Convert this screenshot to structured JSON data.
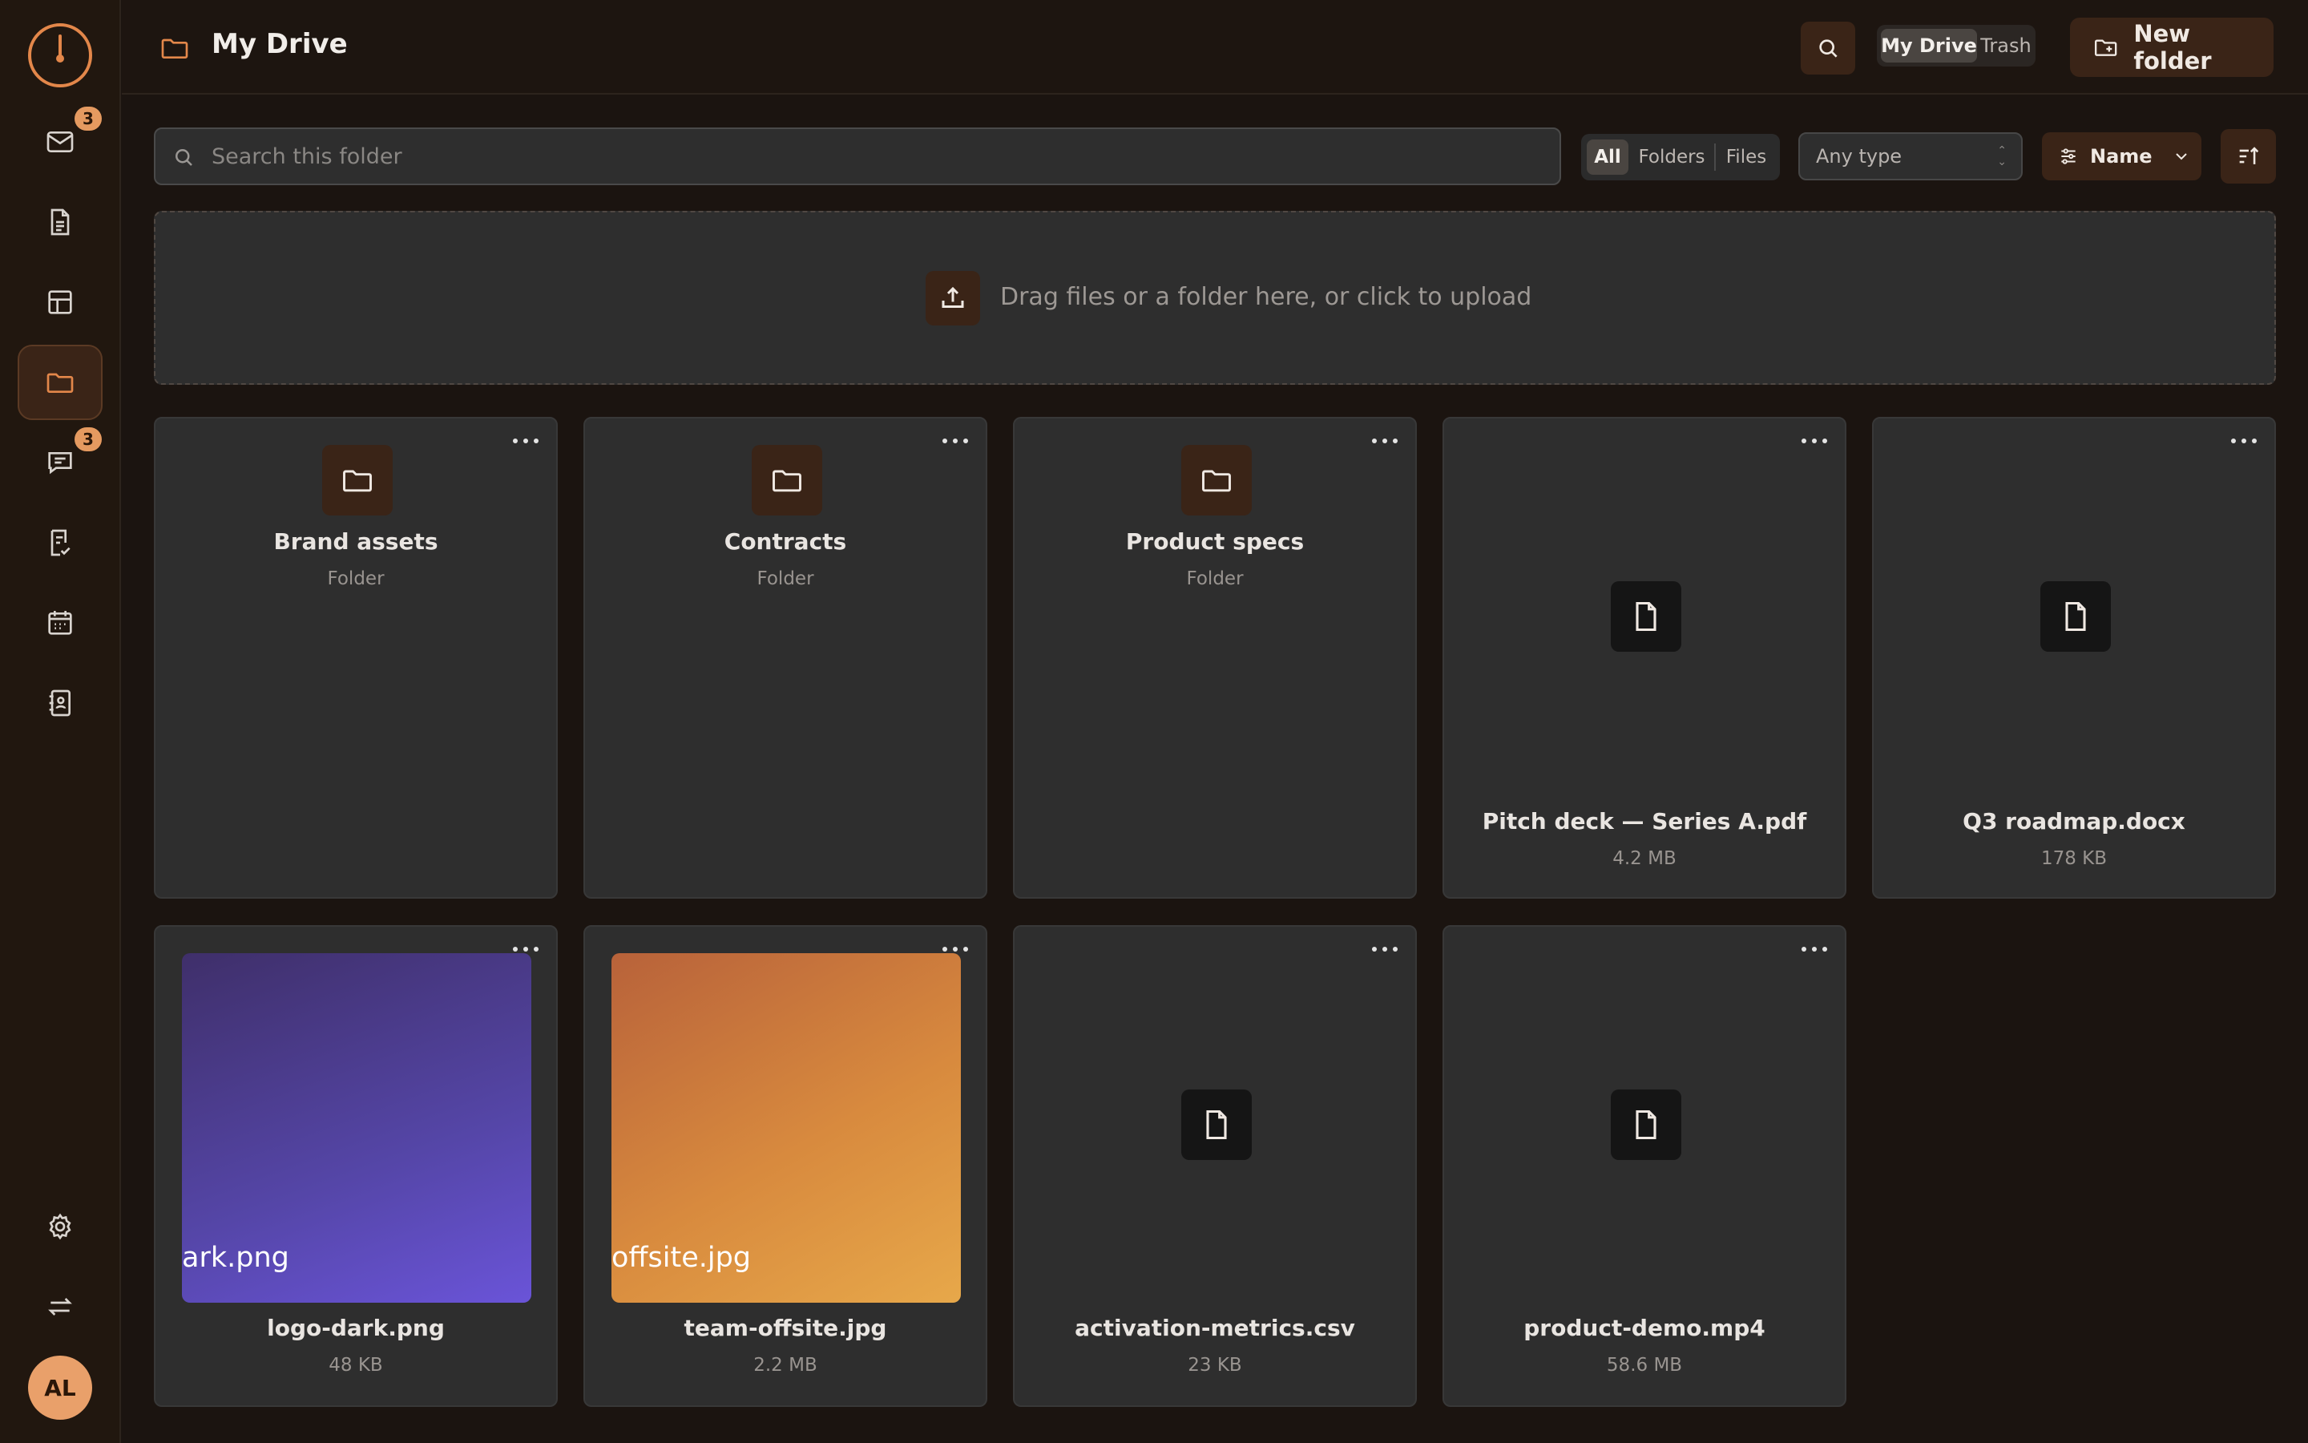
{
  "header": {
    "title": "My Drive",
    "tabs": [
      {
        "label": "My Drive",
        "active": true
      },
      {
        "label": "Trash",
        "active": false
      }
    ],
    "new_folder_label": "New folder"
  },
  "toolbar": {
    "search_placeholder": "Search this folder",
    "filters": [
      {
        "label": "All",
        "active": true
      },
      {
        "label": "Folders",
        "active": false
      },
      {
        "label": "Files",
        "active": false
      }
    ],
    "type_select": "Any type",
    "sort_label": "Name"
  },
  "dropzone": {
    "text": "Drag files or a folder here, or click to upload"
  },
  "sidebar": {
    "badges": {
      "mail": "3",
      "chat": "3"
    },
    "avatar_initials": "AL"
  },
  "items": [
    {
      "name": "Brand assets",
      "meta": "Folder",
      "kind": "folder"
    },
    {
      "name": "Contracts",
      "meta": "Folder",
      "kind": "folder"
    },
    {
      "name": "Product specs",
      "meta": "Folder",
      "kind": "folder"
    },
    {
      "name": "Pitch deck — Series A.pdf",
      "meta": "4.2 MB",
      "kind": "file"
    },
    {
      "name": "Q3 roadmap.docx",
      "meta": "178 KB",
      "kind": "file"
    },
    {
      "name": "logo-dark.png",
      "meta": "48 KB",
      "kind": "image",
      "thumb_text": "ark.png"
    },
    {
      "name": "team-offsite.jpg",
      "meta": "2.2 MB",
      "kind": "image",
      "thumb_text": "offsite.jpg"
    },
    {
      "name": "activation-metrics.csv",
      "meta": "23 KB",
      "kind": "file"
    },
    {
      "name": "product-demo.mp4",
      "meta": "58.6 MB",
      "kind": "file"
    }
  ],
  "colors": {
    "accent": "#e3874a",
    "accent_dark": "#3a2417",
    "card": "#2e2e2e",
    "background": "#1b1410"
  }
}
